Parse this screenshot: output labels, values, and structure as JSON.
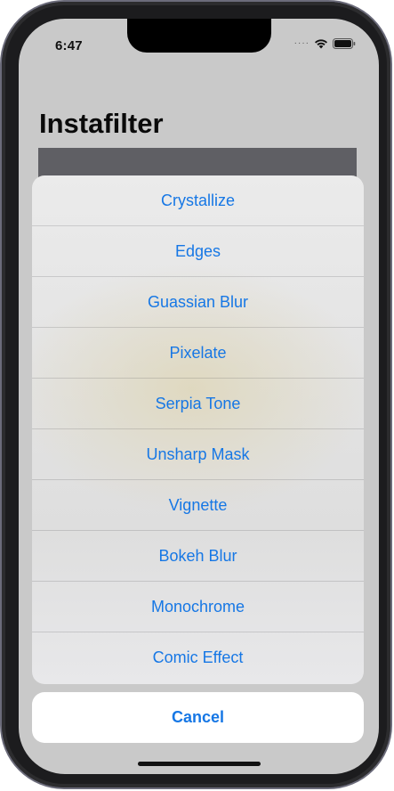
{
  "status_bar": {
    "time": "6:47",
    "signal_icon": "signal-dots-icon",
    "wifi_icon": "wifi-icon",
    "battery_icon": "battery-icon"
  },
  "nav": {
    "title": "Instafilter"
  },
  "action_sheet": {
    "items": [
      {
        "label": "Crystallize"
      },
      {
        "label": "Edges"
      },
      {
        "label": "Guassian Blur"
      },
      {
        "label": "Pixelate"
      },
      {
        "label": "Serpia Tone"
      },
      {
        "label": "Unsharp Mask"
      },
      {
        "label": "Vignette"
      },
      {
        "label": "Bokeh Blur"
      },
      {
        "label": "Monochrome"
      },
      {
        "label": "Comic Effect"
      }
    ],
    "cancel_label": "Cancel",
    "accent_color": "#1677e5"
  }
}
